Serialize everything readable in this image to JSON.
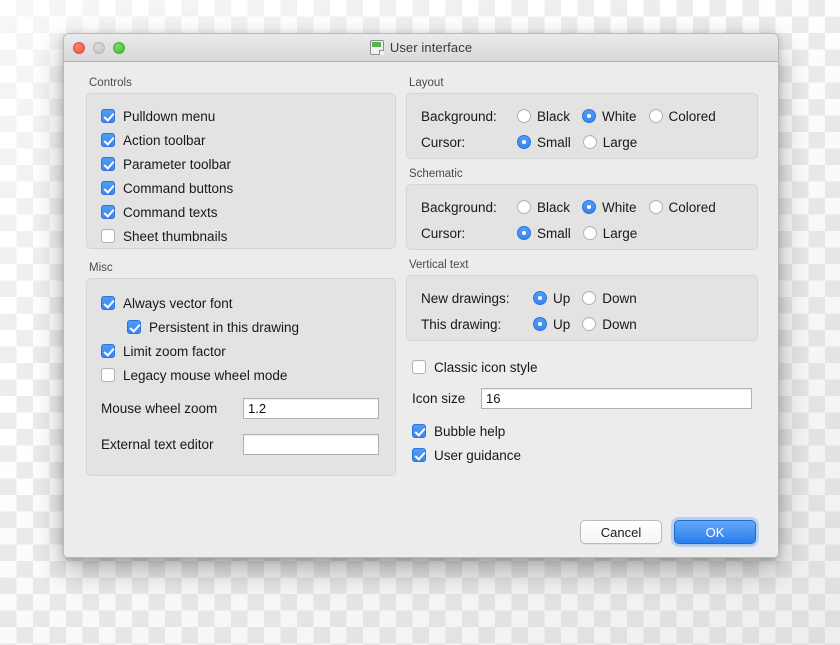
{
  "window": {
    "title": "User interface",
    "icon": "app-document-icon",
    "traffic_lights": [
      "close",
      "minimize",
      "zoom"
    ]
  },
  "controls": {
    "group_label": "Controls",
    "items": [
      {
        "label": "Pulldown menu",
        "checked": true
      },
      {
        "label": "Action toolbar",
        "checked": true
      },
      {
        "label": "Parameter toolbar",
        "checked": true
      },
      {
        "label": "Command buttons",
        "checked": true
      },
      {
        "label": "Command texts",
        "checked": true
      },
      {
        "label": "Sheet thumbnails",
        "checked": false
      }
    ]
  },
  "misc": {
    "group_label": "Misc",
    "items": [
      {
        "label": "Always vector font",
        "checked": true,
        "indent": false
      },
      {
        "label": "Persistent in this drawing",
        "checked": true,
        "indent": true
      },
      {
        "label": "Limit zoom factor",
        "checked": true,
        "indent": false
      },
      {
        "label": "Legacy mouse wheel mode",
        "checked": false,
        "indent": false
      }
    ],
    "mouse_wheel_zoom": {
      "label": "Mouse wheel zoom",
      "value": "1.2",
      "placeholder": ""
    },
    "external_text_editor": {
      "label": "External text editor",
      "value": "",
      "placeholder": ""
    }
  },
  "layout": {
    "group_label": "Layout",
    "background": {
      "label": "Background:",
      "options": [
        "Black",
        "White",
        "Colored"
      ],
      "selected": "White"
    },
    "cursor": {
      "label": "Cursor:",
      "options": [
        "Small",
        "Large"
      ],
      "selected": "Small"
    }
  },
  "schematic": {
    "group_label": "Schematic",
    "background": {
      "label": "Background:",
      "options": [
        "Black",
        "White",
        "Colored"
      ],
      "selected": "White"
    },
    "cursor": {
      "label": "Cursor:",
      "options": [
        "Small",
        "Large"
      ],
      "selected": "Small"
    }
  },
  "vertical_text": {
    "group_label": "Vertical text",
    "new_drawings": {
      "label": "New drawings:",
      "options": [
        "Up",
        "Down"
      ],
      "selected": "Up"
    },
    "this_drawing": {
      "label": "This drawing:",
      "options": [
        "Up",
        "Down"
      ],
      "selected": "Up"
    }
  },
  "icons": {
    "classic_icon_style": {
      "label": "Classic icon style",
      "checked": false
    },
    "icon_size": {
      "label": "Icon size",
      "value": "16",
      "placeholder": ""
    },
    "bubble_help": {
      "label": "Bubble help",
      "checked": true
    },
    "user_guidance": {
      "label": "User guidance",
      "checked": true
    }
  },
  "footer": {
    "cancel_label": "Cancel",
    "ok_label": "OK"
  },
  "colors": {
    "accent": "#3b85ef",
    "window_bg": "#ececec",
    "group_bg": "#e3e3e3"
  }
}
